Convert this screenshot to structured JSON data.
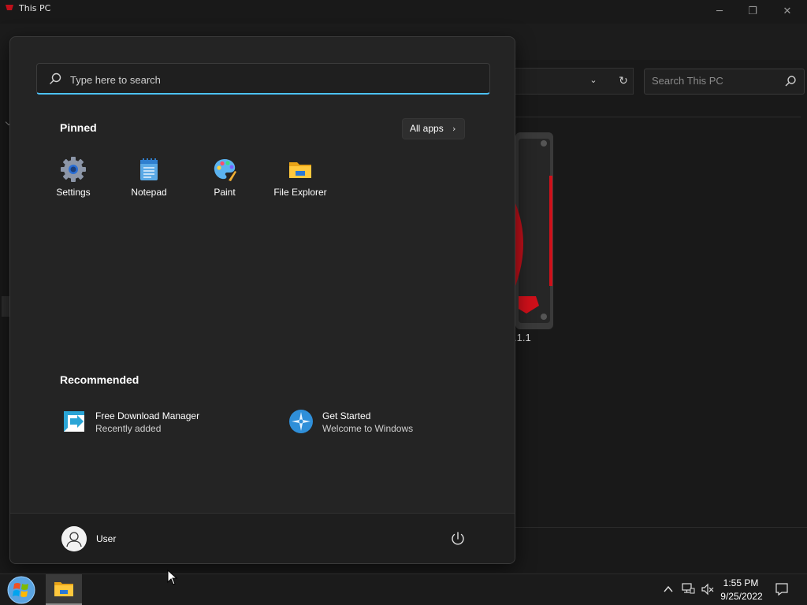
{
  "explorer": {
    "title": "This PC",
    "search_placeholder": "Search This PC",
    "drive_label": ".1.1"
  },
  "start_menu": {
    "search_placeholder": "Type here to search",
    "pinned_title": "Pinned",
    "all_apps_label": "All apps",
    "pinned": [
      {
        "label": "Settings",
        "icon": "settings-gear-icon"
      },
      {
        "label": "Notepad",
        "icon": "notepad-icon"
      },
      {
        "label": "Paint",
        "icon": "paint-palette-icon"
      },
      {
        "label": "File Explorer",
        "icon": "folder-icon"
      }
    ],
    "recommended_title": "Recommended",
    "recommended": [
      {
        "title": "Free Download Manager",
        "subtitle": "Recently added",
        "icon": "fdm-icon"
      },
      {
        "title": "Get Started",
        "subtitle": "Welcome to Windows",
        "icon": "get-started-icon"
      }
    ],
    "user_name": "User"
  },
  "taskbar": {
    "time": "1:55 PM",
    "date": "9/25/2022"
  },
  "colors": {
    "accent": "#4cc2ff",
    "menu_bg": "#242424",
    "footer_bg": "#1e1e1e",
    "taskbar_bg": "#1b1b1b"
  }
}
